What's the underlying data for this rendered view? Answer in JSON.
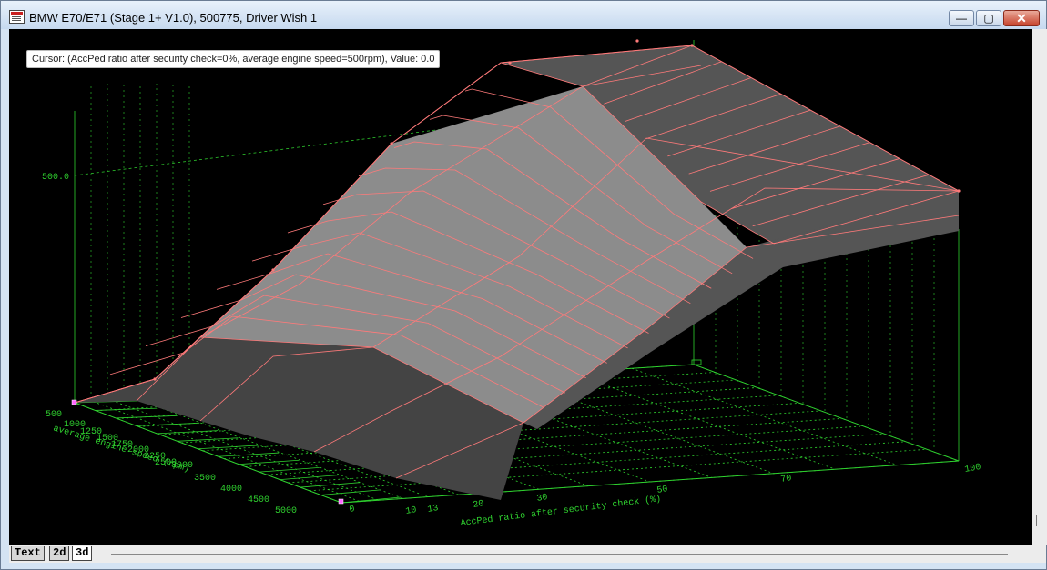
{
  "window": {
    "title": "BMW E70/E71 (Stage 1+ V1.0), 500775, Driver Wish 1",
    "minimize_glyph": "—",
    "maximize_glyph": "▢",
    "close_glyph": "✕"
  },
  "cursor_readout": "Cursor: (AccPed ratio after security check=0%, average engine speed=500rpm), Value: 0.0",
  "plot": {
    "z_tick_label": "500.0",
    "x_axis_label": "AccPed ratio after security check (%)",
    "y_axis_label": "average engine speed (rpm)",
    "x_ticks": [
      "0",
      "10",
      "13",
      "20",
      "30",
      "50",
      "70",
      "100"
    ],
    "y_ticks": [
      "500",
      "1000",
      "1250",
      "1500",
      "1750",
      "2000",
      "2250",
      "2500",
      "3000",
      "3500",
      "4000",
      "4500",
      "5000"
    ]
  },
  "tabs": [
    {
      "label": "Text"
    },
    {
      "label": "2d"
    },
    {
      "label": "3d"
    }
  ],
  "colors": {
    "plot_background": "#000000",
    "grid": "#2fd12f",
    "surface_mesh": "#ff7a7a",
    "surface_fill": "#8c8c8c"
  }
}
